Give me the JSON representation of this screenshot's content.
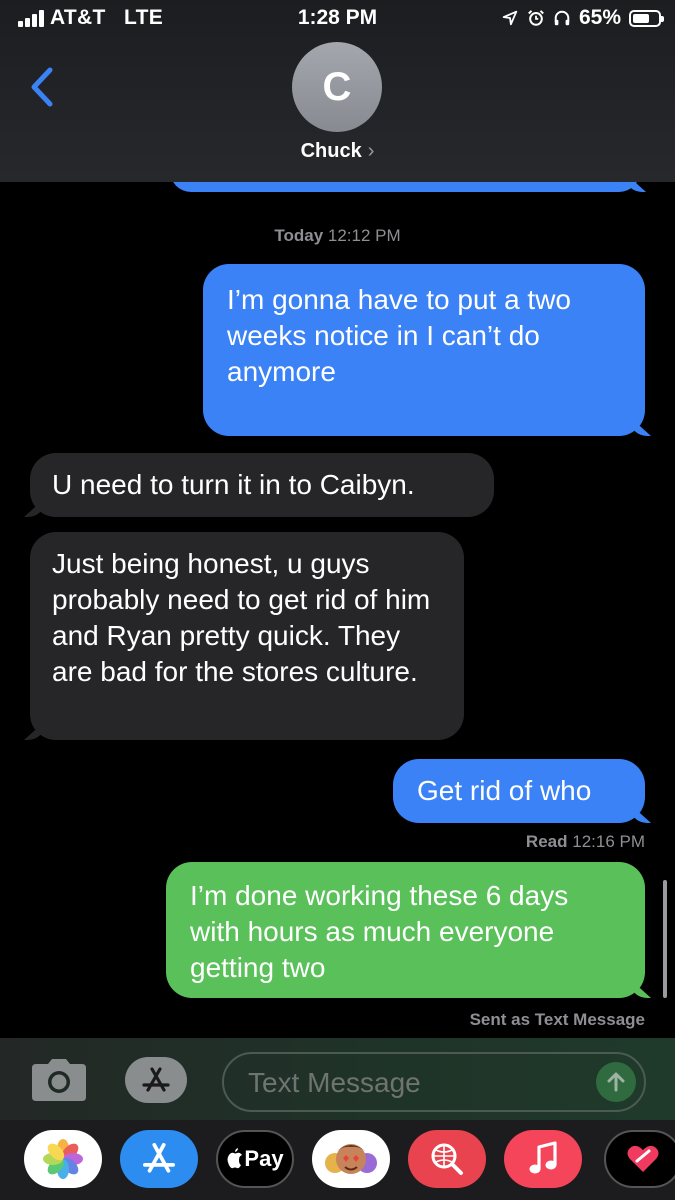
{
  "status_bar": {
    "carrier": "AT&T",
    "network": "LTE",
    "time": "1:28 PM",
    "battery_percent": "65%",
    "battery_level": 0.65,
    "icons": [
      "location-arrow-icon",
      "alarm-icon",
      "headphones-icon"
    ]
  },
  "header": {
    "contact_initial": "C",
    "contact_name": "Chuck",
    "chevron": "›"
  },
  "messages": [
    {
      "type": "timestamp",
      "label": "Today",
      "time": "12:12 PM"
    },
    {
      "type": "outgoing-imessage",
      "text": "I’m gonna have to put a two weeks notice in I can’t do anymore"
    },
    {
      "type": "incoming",
      "text": "U need to turn it in to Caibyn."
    },
    {
      "type": "incoming",
      "text": "Just being honest, u guys probably need to get rid of him and Ryan pretty quick. They are bad for the stores culture."
    },
    {
      "type": "outgoing-imessage",
      "text": "Get rid of who"
    },
    {
      "type": "read-receipt",
      "label": "Read",
      "time": "12:16 PM"
    },
    {
      "type": "outgoing-sms",
      "text": "I’m done working these 6 days with hours as much everyone getting two"
    },
    {
      "type": "delivery-note",
      "text": "Sent as Text Message"
    }
  ],
  "compose": {
    "placeholder": "Text Message"
  },
  "app_drawer": {
    "apps": [
      "photos-app-icon",
      "app-store-icon",
      "apple-pay-icon",
      "memoji-stickers-icon",
      "web-search-icon",
      "music-app-icon",
      "digital-touch-icon"
    ],
    "apple_pay_label": "Pay"
  },
  "colors": {
    "imessage_blue": "#3b82f6",
    "sms_green": "#5ac05a",
    "incoming_gray": "#262629",
    "back_blue": "#3b82f6"
  }
}
